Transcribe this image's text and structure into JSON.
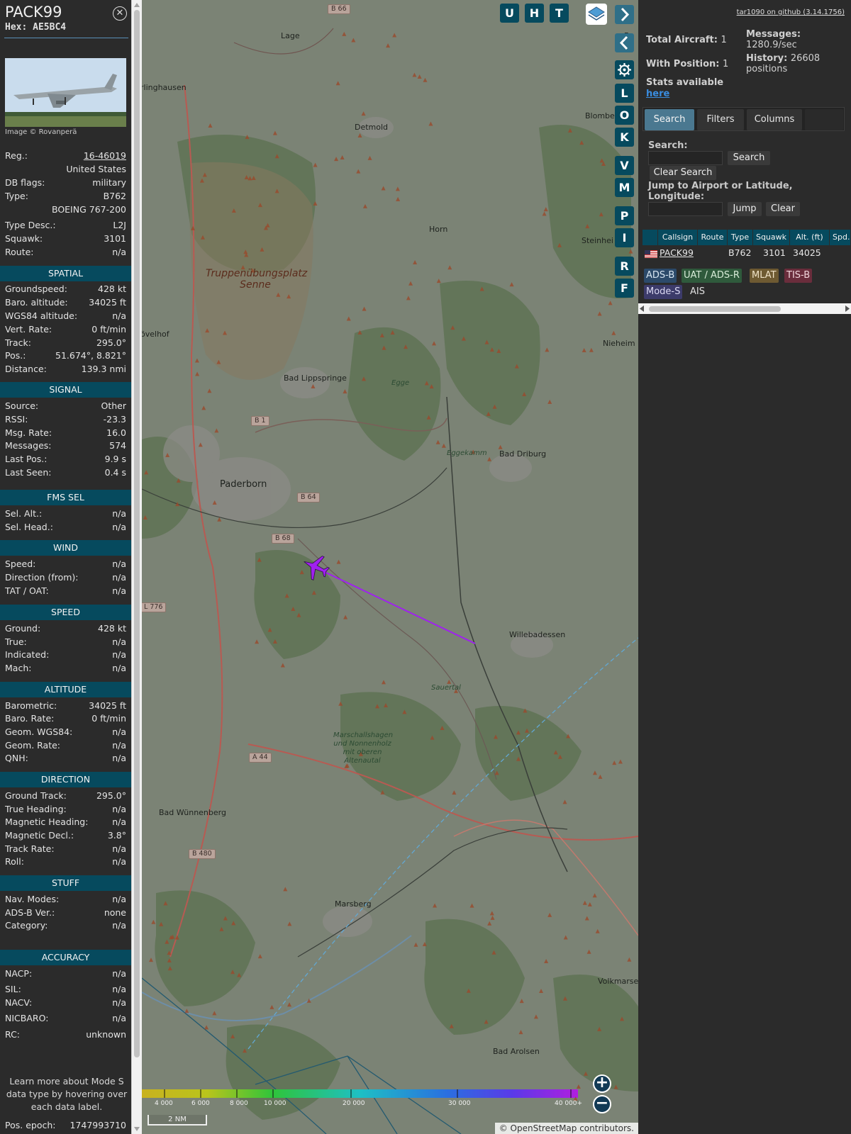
{
  "aircraft": {
    "callsign": "PACK99",
    "hex_label": "Hex:",
    "hex": "AE5BC4",
    "image_credit": "Image © Rovanperä"
  },
  "details": [
    {
      "k": "Reg.:",
      "v": "16-46019",
      "link": true
    },
    {
      "k": "",
      "v": "United States"
    },
    {
      "k": "DB flags:",
      "v": "military"
    },
    {
      "k": "Type:",
      "v": "B762"
    },
    {
      "k": "",
      "v": "BOEING 767-200"
    },
    {
      "k": "Type Desc.:",
      "v": "L2J"
    },
    {
      "k": "Squawk:",
      "v": "3101"
    },
    {
      "k": "Route:",
      "v": "n/a"
    }
  ],
  "sections": [
    {
      "title": "SPATIAL",
      "rows": [
        {
          "k": "Groundspeed:",
          "v": "428 kt"
        },
        {
          "k": "Baro. altitude:",
          "v": "34025 ft"
        },
        {
          "k": "WGS84 altitude:",
          "v": "n/a"
        },
        {
          "k": "Vert. Rate:",
          "v": "0 ft/min"
        },
        {
          "k": "Track:",
          "v": "295.0°"
        },
        {
          "k": "Pos.:",
          "v": "51.674°, 8.821°"
        },
        {
          "k": "Distance:",
          "v": "139.3 nmi"
        }
      ]
    },
    {
      "title": "SIGNAL",
      "rows": [
        {
          "k": "Source:",
          "v": "Other"
        },
        {
          "k": "RSSI:",
          "v": "-23.3"
        },
        {
          "k": "Msg. Rate:",
          "v": "16.0"
        },
        {
          "k": "Messages:",
          "v": "574"
        },
        {
          "k": "Last Pos.:",
          "v": "9.9 s"
        },
        {
          "k": "Last Seen:",
          "v": "0.4 s"
        }
      ]
    },
    {
      "title": "FMS SEL",
      "rows": [
        {
          "k": "Sel. Alt.:",
          "v": "n/a"
        },
        {
          "k": "Sel. Head.:",
          "v": "n/a"
        }
      ]
    },
    {
      "title": "WIND",
      "rows": [
        {
          "k": "Speed:",
          "v": "n/a"
        },
        {
          "k": "Direction (from):",
          "v": "n/a"
        },
        {
          "k": "TAT / OAT:",
          "v": "n/a"
        }
      ]
    },
    {
      "title": "SPEED",
      "rows": [
        {
          "k": "Ground:",
          "v": "428 kt"
        },
        {
          "k": "True:",
          "v": "n/a"
        },
        {
          "k": "Indicated:",
          "v": "n/a"
        },
        {
          "k": "Mach:",
          "v": "n/a"
        }
      ]
    },
    {
      "title": "ALTITUDE",
      "rows": [
        {
          "k": "Barometric:",
          "v": "34025 ft"
        },
        {
          "k": "Baro. Rate:",
          "v": "0 ft/min"
        },
        {
          "k": "Geom. WGS84:",
          "v": "n/a"
        },
        {
          "k": "Geom. Rate:",
          "v": "n/a"
        },
        {
          "k": "QNH:",
          "v": "n/a"
        }
      ]
    },
    {
      "title": "DIRECTION",
      "rows": [
        {
          "k": "Ground Track:",
          "v": "295.0°"
        },
        {
          "k": "True Heading:",
          "v": "n/a"
        },
        {
          "k": "Magnetic Heading:",
          "v": "n/a"
        },
        {
          "k": "Magnetic Decl.:",
          "v": "3.8°"
        },
        {
          "k": "Track Rate:",
          "v": "n/a"
        },
        {
          "k": "Roll:",
          "v": "n/a"
        }
      ]
    },
    {
      "title": "STUFF",
      "rows": [
        {
          "k": "Nav. Modes:",
          "v": "n/a"
        },
        {
          "k": "ADS-B Ver.:",
          "v": "none"
        },
        {
          "k": "Category:",
          "v": "n/a"
        }
      ]
    },
    {
      "title": "ACCURACY",
      "rows": [
        {
          "k": "NACP:",
          "v": "n/a"
        },
        {
          "k": "SIL:",
          "v": "n/a"
        },
        {
          "k": "NACV:",
          "v": "n/a"
        },
        {
          "k": "NICBARO:",
          "v": "n/a"
        },
        {
          "k": "RC:",
          "v": "unknown"
        }
      ]
    }
  ],
  "learn_more": "Learn more about Mode S data type by hovering over each data label.",
  "pos_epoch": {
    "k": "Pos. epoch:",
    "v": "1747993710"
  },
  "map": {
    "top_buttons": [
      "U",
      "H",
      "T"
    ],
    "side_buttons": [
      "L",
      "O",
      "K",
      "V",
      "M",
      "P",
      "I",
      "R",
      "F"
    ],
    "places": [
      {
        "name": "Lage",
        "cls": ""
      },
      {
        "name": "rlinghausen",
        "cls": ""
      },
      {
        "name": "Detmold",
        "cls": ""
      },
      {
        "name": "Blomber",
        "cls": ""
      },
      {
        "name": "Horn",
        "cls": ""
      },
      {
        "name": "Steinhei",
        "cls": ""
      },
      {
        "name": "Nieheim",
        "cls": ""
      },
      {
        "name": "Bad Lippspringe",
        "cls": ""
      },
      {
        "name": "Bad Driburg",
        "cls": ""
      },
      {
        "name": "Paderborn",
        "cls": "big"
      },
      {
        "name": "Willebadessen",
        "cls": ""
      },
      {
        "name": "Bad Wünnenberg",
        "cls": ""
      },
      {
        "name": "Marsberg",
        "cls": ""
      },
      {
        "name": "Volkmarse",
        "cls": ""
      },
      {
        "name": "Bad Arolsen",
        "cls": ""
      },
      {
        "name": "övelhof",
        "cls": ""
      },
      {
        "name": "Ba",
        "cls": ""
      },
      {
        "name": "Egge",
        "cls": "it"
      },
      {
        "name": "Eggekamm",
        "cls": "it"
      },
      {
        "name": "Sauertal",
        "cls": "it"
      },
      {
        "name": "Marschallshagen und Nonnenholz mit oberen Altenautal",
        "cls": "it"
      },
      {
        "name": "Truppenübungsplatz Senne",
        "cls": "area"
      }
    ],
    "roads": [
      "B 66",
      "B 1",
      "B 64",
      "B 68",
      "A 44",
      "B 480",
      "L 776"
    ],
    "legend_ticks": [
      "4 000",
      "6 000",
      "8 000",
      "10 000",
      "20 000",
      "30 000",
      "40 000+"
    ],
    "scale": "2 NM",
    "attribution": "© OpenStreetMap contributors."
  },
  "right": {
    "github": "tar1090 on github (3.14.1756)",
    "total_label": "Total Aircraft:",
    "total": "1",
    "withpos_label": "With Position:",
    "withpos": "1",
    "messages_label": "Messages:",
    "messages": "1280.9/sec",
    "history_label": "History:",
    "history": "26608 positions",
    "stats_label": "Stats available",
    "stats_link": "here",
    "tabs": [
      "Search",
      "Filters",
      "Columns"
    ],
    "search_label": "Search:",
    "search_btn": "Search",
    "clear_search_btn": "Clear Search",
    "jump_label": "Jump to Airport or Latitude, Longitude:",
    "jump_btn": "Jump",
    "clear_btn": "Clear",
    "columns": [
      "",
      "Callsign",
      "Route",
      "Type",
      "Squawk",
      "Alt. (ft)",
      "Spd."
    ],
    "row": {
      "callsign": "PACK99",
      "type": "B762",
      "squawk": "3101",
      "alt": "34025"
    },
    "sources": [
      "ADS-B",
      "UAT / ADS-R",
      "MLAT",
      "TIS-B",
      "Mode-S",
      "AIS"
    ]
  }
}
